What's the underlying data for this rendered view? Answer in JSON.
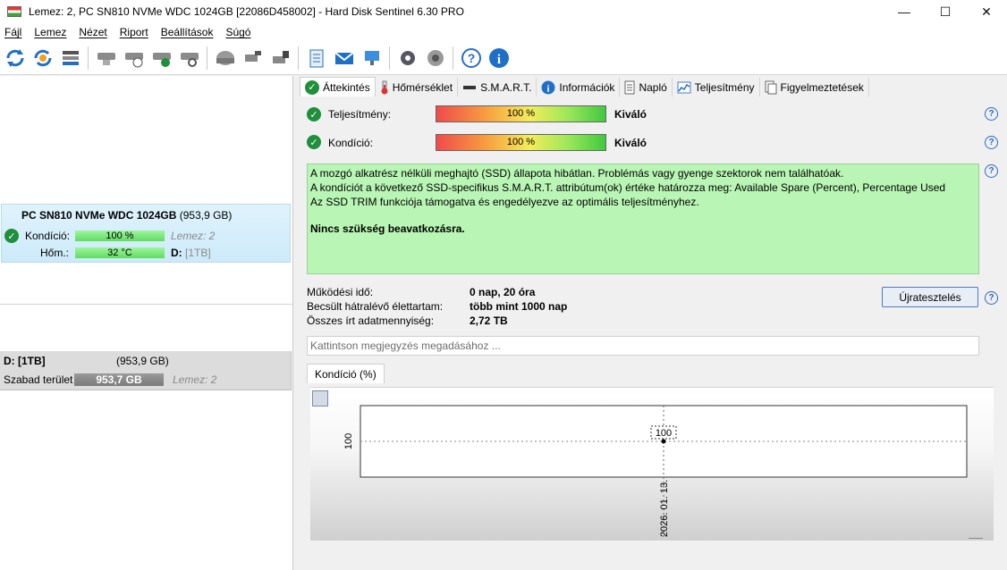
{
  "window": {
    "title": "Lemez: 2, PC SN810 NVMe WDC 1024GB [22086D458002]  -  Hard Disk Sentinel 6.30 PRO",
    "minimize": "—",
    "maximize": "☐",
    "close": "✕"
  },
  "menu": [
    "Fájl",
    "Lemez",
    "Nézet",
    "Riport",
    "Beállítások",
    "Súgó"
  ],
  "disk": {
    "name": "PC SN810 NVMe WDC 1024GB",
    "size": "(953,9 GB)",
    "condition_label": "Kondíció:",
    "condition_value": "100 %",
    "condition_fill": 1.0,
    "disk_index": "Lemez: 2",
    "temp_label": "Hőm.:",
    "temp_value": "32 °C",
    "drive_letter": "D:",
    "drive_desc": "[1TB]"
  },
  "volume": {
    "name": "D: [1TB]",
    "size": "(953,9 GB)",
    "free_label": "Szabad terület",
    "free_value": "953,7 GB",
    "disk_index": "Lemez: 2"
  },
  "tabs": [
    {
      "label": "Áttekintés",
      "icon": "check-icon"
    },
    {
      "label": "Hőmérséklet",
      "icon": "thermometer-icon"
    },
    {
      "label": "S.M.A.R.T.",
      "icon": "smart-icon"
    },
    {
      "label": "Információk",
      "icon": "info-icon"
    },
    {
      "label": "Napló",
      "icon": "log-icon"
    },
    {
      "label": "Teljesítmény",
      "icon": "performance-icon"
    },
    {
      "label": "Figyelmeztetések",
      "icon": "alerts-icon"
    }
  ],
  "overview": {
    "performance_label": "Teljesítmény:",
    "performance_value": "100 %",
    "performance_rating": "Kiváló",
    "health_label": "Kondíció:",
    "health_value": "100 %",
    "health_rating": "Kiváló",
    "summary_lines": [
      "A mozgó alkatrész nélküli meghajtó (SSD) állapota hibátlan. Problémás vagy gyenge szektorok nem találhatóak.",
      "A kondíciót a következő SSD-specifikus S.M.A.R.T. attribútum(ok) értéke határozza meg:  Available Spare (Percent), Percentage Used",
      "Az SSD TRIM funkciója támogatva és engedélyezve az optimális teljesítményhez."
    ],
    "summary_action": "Nincs szükség beavatkozásra.",
    "power_on_label": "Működési idő:",
    "power_on_value": "0 nap, 20 óra",
    "remaining_label": "Becsült hátralévő élettartam:",
    "remaining_value": "több mint 1000 nap",
    "written_label": "Összes írt adatmennyiség:",
    "written_value": "2,72 TB",
    "retest_button": "Újratesztelés",
    "note_placeholder": "Kattintson megjegyzés megadásához ..."
  },
  "chart_tab": "Kondíció  (%)",
  "chart_data": {
    "type": "line",
    "x": [
      "2026. 01. 13."
    ],
    "series": [
      {
        "values": [
          100
        ]
      }
    ],
    "data_labels": [
      "100"
    ],
    "y_tick_labels": [
      "100"
    ],
    "grid": true
  }
}
